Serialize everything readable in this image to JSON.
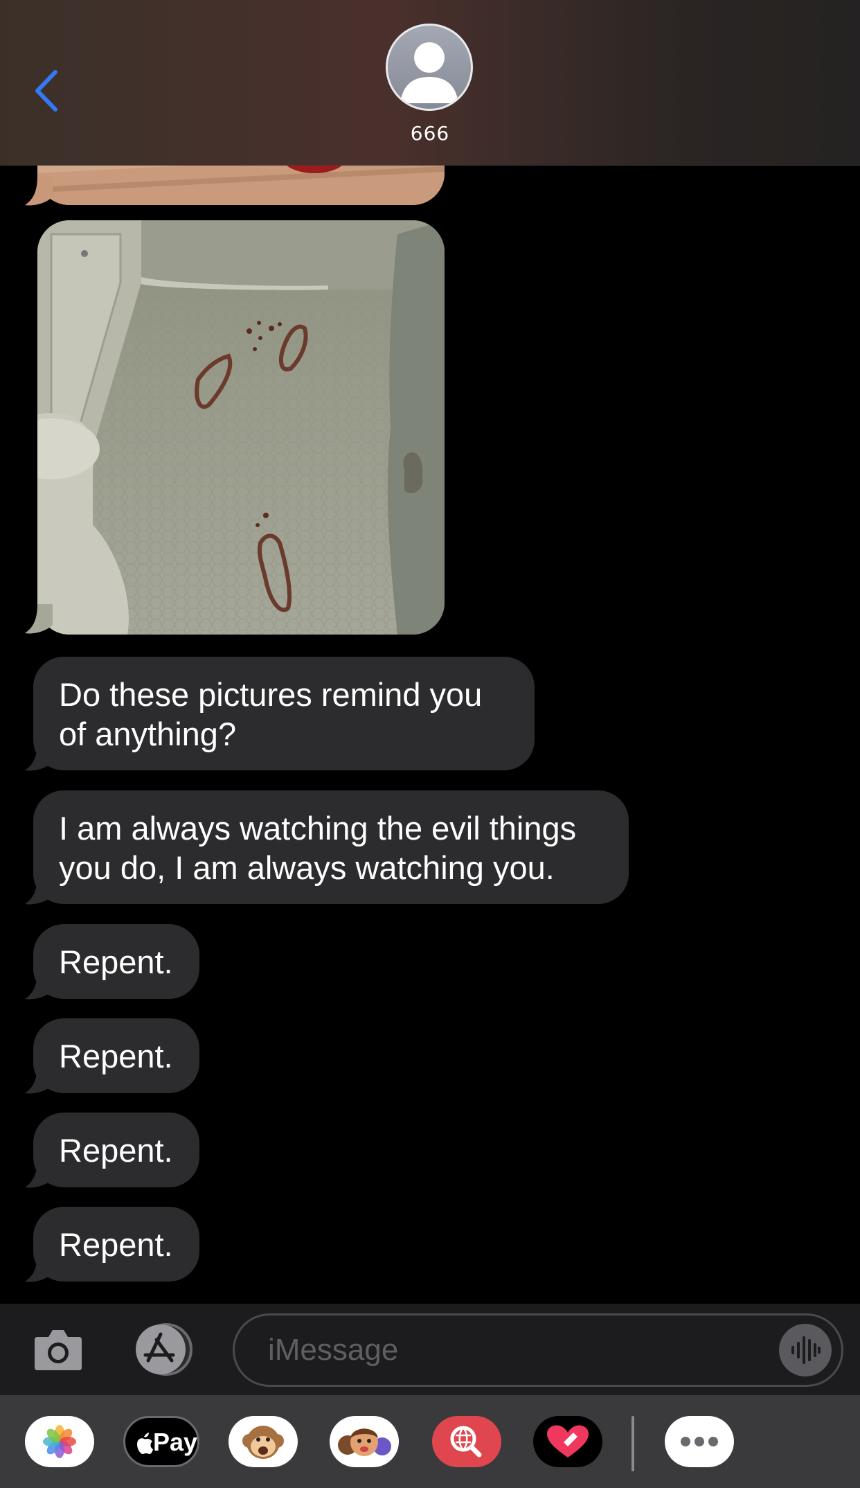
{
  "header": {
    "contact_name": "666",
    "back_icon": "chevron-left-icon",
    "avatar_icon": "person-silhouette-icon"
  },
  "messages": [
    {
      "type": "image",
      "description_icon": "photo-icon"
    },
    {
      "type": "image",
      "description_icon": "photo-icon"
    },
    {
      "type": "text",
      "text": "Do these pictures remind you of anything?"
    },
    {
      "type": "text",
      "text": "I am always watching the evil things you do, I am always watching you."
    },
    {
      "type": "text",
      "text": "Repent."
    },
    {
      "type": "text",
      "text": "Repent."
    },
    {
      "type": "text",
      "text": "Repent."
    },
    {
      "type": "text",
      "text": "Repent."
    }
  ],
  "input_bar": {
    "camera_icon": "camera-icon",
    "apps_icon": "app-store-icon",
    "placeholder": "iMessage",
    "audio_icon": "audio-waveform-icon"
  },
  "app_drawer": {
    "apps": [
      {
        "name": "photos-app-icon"
      },
      {
        "name": "apple-pay-app-icon",
        "label": "Pay"
      },
      {
        "name": "animoji-app-icon"
      },
      {
        "name": "memoji-app-icon"
      },
      {
        "name": "images-search-app-icon"
      },
      {
        "name": "digital-touch-app-icon"
      },
      {
        "name": "more-apps-icon"
      }
    ]
  },
  "colors": {
    "accent": "#3478f6",
    "bubble": "#2c2c2e",
    "background": "#000000"
  }
}
